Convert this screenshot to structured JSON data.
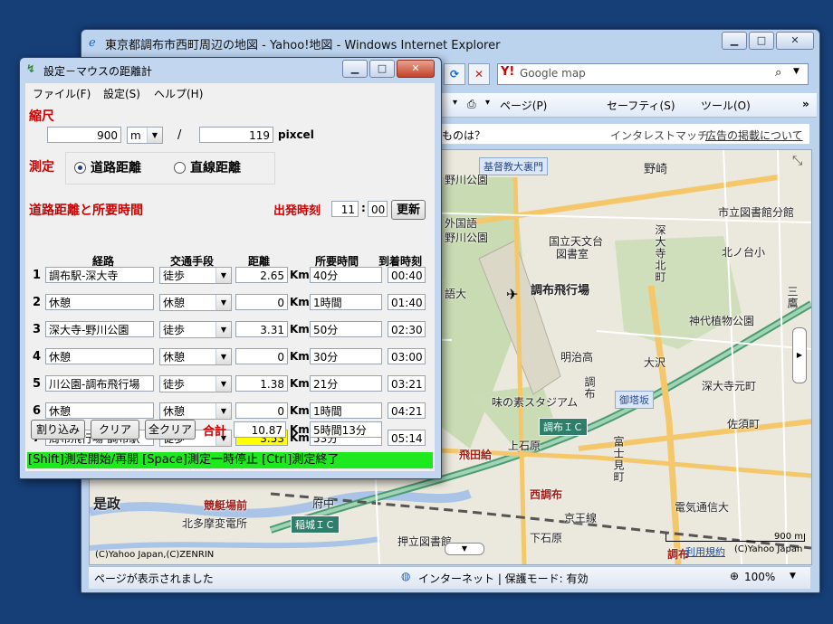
{
  "ie": {
    "title": "東京都調布市西町周辺の地図 - Yahoo!地図 - Windows Internet Explorer",
    "search_placeholder": "Google map",
    "commands": [
      "ページ(P)",
      "セーフティ(S)",
      "ツール(O)"
    ],
    "info_left": "ものは？",
    "info_right_prefix": "インタレストマッチ - ",
    "info_right_link": "広告の掲載について",
    "status_text": "ページが表示されました",
    "zone_text": "インターネット | 保護モード: 有効",
    "zoom": "100%"
  },
  "map": {
    "labels": [
      "基督教大裏門",
      "野川公園",
      "外国語",
      "野川公園",
      "語大",
      "国立天文台",
      "図書室",
      "調布飛行場",
      "明治高",
      "大沢",
      "深大寺元町",
      "佐須町",
      "御塔坂",
      "味の素スタジアム",
      "調布ＩＣ",
      "上石原",
      "飛田給",
      "西調布",
      "電気通信大",
      "競艇場前",
      "北多摩変電所",
      "稲城ＩＣ",
      "押立図書館",
      "下石原",
      "京王線",
      "是政",
      "市立図書館分館",
      "北ノ台小",
      "神代植物公園",
      "野崎",
      "三鷹",
      "深大寺北町",
      "富士見町",
      "調布",
      "調布",
      "府中"
    ],
    "scale": "900 m",
    "copyright": "(C)Yahoo Japan,(C)ZENRIN",
    "copyright2": "(C)Yahoo Japan",
    "usage_link": "利用規約"
  },
  "dialog": {
    "title": "設定－マウスの距離計",
    "menus": [
      "ファイル(F)",
      "設定(S)",
      "ヘルプ(H)"
    ],
    "scale_label": "縮尺",
    "scale_value": "900",
    "scale_unit": "m",
    "slash": "/",
    "pixel_value": "119",
    "pixel_unit": "pixcel",
    "measure_label": "測定",
    "radio_road": "道路距離",
    "radio_straight": "直線距離",
    "radio_selected": "road",
    "section_label": "道路距離と所要時間",
    "depart_label": "出発時刻",
    "depart_hour": "11",
    "depart_sep": ":",
    "depart_min": "00",
    "update_button": "更新",
    "headers": {
      "route": "経路",
      "mode": "交通手段",
      "distance": "距離",
      "time": "所要時間",
      "arrival": "到着時刻"
    },
    "unit": "Km",
    "rows": [
      {
        "num": "1",
        "route": "調布駅-深大寺",
        "mode": "徒歩",
        "distance": "2.65",
        "time": "40分",
        "arrival": "00:40",
        "highlight": false
      },
      {
        "num": "2",
        "route": "休憩",
        "mode": "休憩",
        "distance": "0",
        "time": "1時間",
        "arrival": "01:40",
        "highlight": false
      },
      {
        "num": "3",
        "route": "深大寺-野川公園",
        "mode": "徒歩",
        "distance": "3.31",
        "time": "50分",
        "arrival": "02:30",
        "highlight": false
      },
      {
        "num": "4",
        "route": "休憩",
        "mode": "休憩",
        "distance": "0",
        "time": "30分",
        "arrival": "03:00",
        "highlight": false
      },
      {
        "num": "5",
        "route": "川公園-調布飛行場",
        "mode": "徒歩",
        "distance": "1.38",
        "time": "21分",
        "arrival": "03:21",
        "highlight": false
      },
      {
        "num": "6",
        "route": "休憩",
        "mode": "休憩",
        "distance": "0",
        "time": "1時間",
        "arrival": "04:21",
        "highlight": false
      },
      {
        "num": "7",
        "route": "周布飛行場-調布駅",
        "mode": "徒歩",
        "distance": "3.53",
        "time": "53分",
        "arrival": "05:14",
        "highlight": true
      }
    ],
    "buttons": {
      "insert": "割り込み",
      "clear": "クリア",
      "clear_all": "全クリア"
    },
    "total_label": "合計",
    "total_distance": "10.87",
    "total_time": "5時間13分",
    "hint": "[Shift]測定開始/再開 [Space]測定一時停止 [Ctrl]測定終了"
  },
  "colors": {
    "desktop": "#163f78",
    "hint_bg": "#1ee81e",
    "highlight": "#ffff00",
    "accent_red": "#cc0000"
  }
}
